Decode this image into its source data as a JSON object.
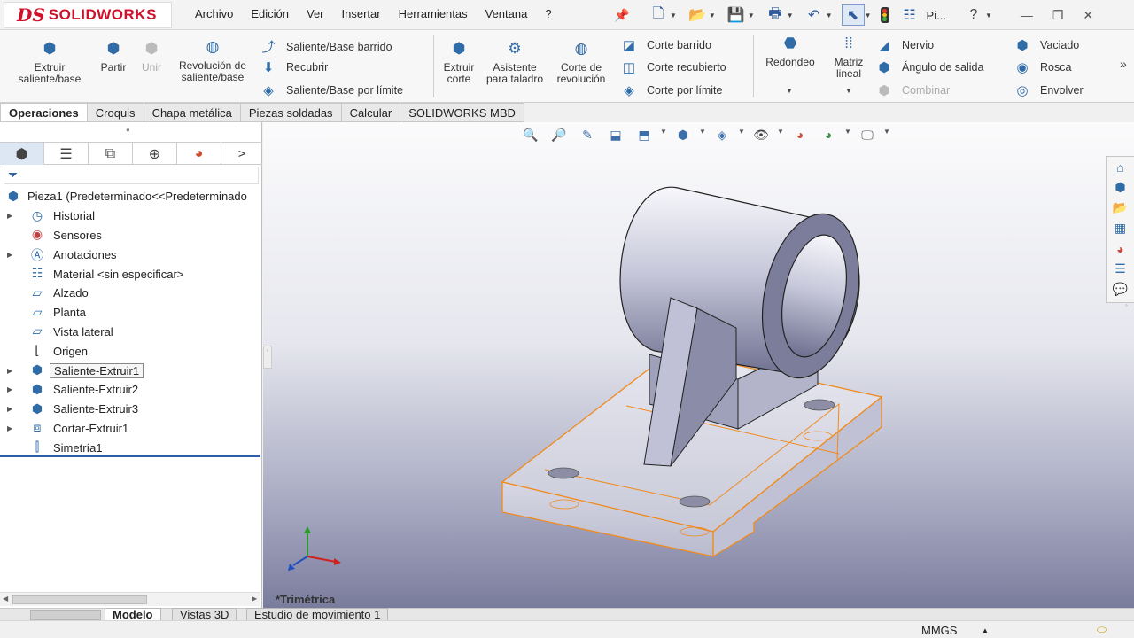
{
  "app": {
    "logo_prefix": "DS",
    "logo_name": "SOLIDWORKS",
    "doc_name": "Pi..."
  },
  "menu": [
    "Archivo",
    "Edición",
    "Ver",
    "Insertar",
    "Herramientas",
    "Ventana",
    "?"
  ],
  "command_manager": {
    "extruir_saliente": "Extruir saliente/base",
    "partir": "Partir",
    "unir": "Unir",
    "revolucion": "Revolución de saliente/base",
    "saliente_barrido": "Saliente/Base barrido",
    "recubrir": "Recubrir",
    "saliente_limite": "Saliente/Base por límite",
    "extruir_corte": "Extruir corte",
    "asistente_taladro": "Asistente para taladro",
    "corte_revolucion": "Corte de revolución",
    "corte_barrido": "Corte barrido",
    "corte_recubierto": "Corte recubierto",
    "corte_limite": "Corte por límite",
    "redondeo": "Redondeo",
    "matriz_lineal": "Matriz lineal",
    "nervio": "Nervio",
    "angulo_salida": "Ángulo de salida",
    "combinar": "Combinar",
    "vaciado": "Vaciado",
    "rosca": "Rosca",
    "envolver": "Envolver"
  },
  "tabs": [
    "Operaciones",
    "Croquis",
    "Chapa metálica",
    "Piezas soldadas",
    "Calcular",
    "SOLIDWORKS MBD"
  ],
  "tree": {
    "root": "Pieza1  (Predeterminado<<Predeterminado",
    "items": [
      "Historial",
      "Sensores",
      "Anotaciones",
      "Material <sin especificar>",
      "Alzado",
      "Planta",
      "Vista lateral",
      "Origen",
      "Saliente-Extruir1",
      "Saliente-Extruir2",
      "Saliente-Extruir3",
      "Cortar-Extruir1",
      "Simetría1"
    ]
  },
  "viewport": {
    "view_name": "*Trimétrica"
  },
  "bottom_tabs": [
    "Modelo",
    "Vistas 3D",
    "Estudio de movimiento 1"
  ],
  "status": {
    "units": "MMGS"
  },
  "colors": {
    "brand": "#d0112b",
    "selection": "#f08a1c",
    "accent": "#2f6ca8"
  }
}
